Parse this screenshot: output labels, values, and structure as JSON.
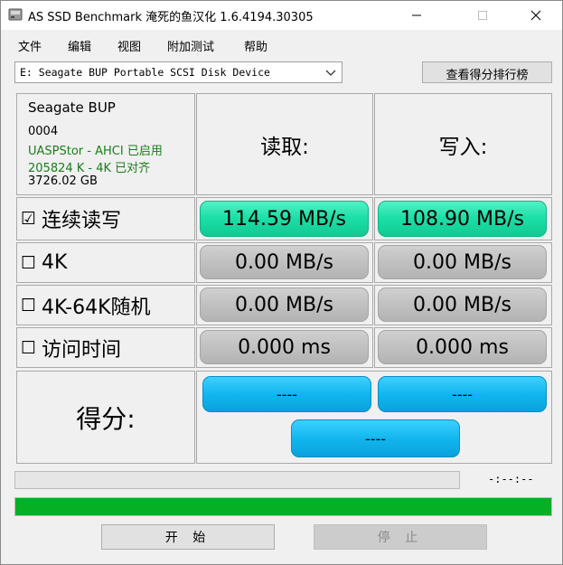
{
  "window": {
    "title": "AS SSD Benchmark 淹死的鱼汉化 1.6.4194.30305"
  },
  "menu": {
    "items": [
      "文件",
      "编辑",
      "视图",
      "附加测试",
      "帮助"
    ]
  },
  "toolbar": {
    "device_selected": "E: Seagate BUP Portable SCSI Disk Device",
    "rank_button": "查看得分排行榜"
  },
  "info": {
    "name": "Seagate BUP",
    "firmware": "0004",
    "driver": "UASPStor - AHCI 已启用",
    "alignment": "205824 K - 4K 已对齐",
    "capacity": "3726.02 GB",
    "ok_color": "#1a7d1a"
  },
  "headers": {
    "read": "读取:",
    "write": "写入:"
  },
  "rows": [
    {
      "checkbox": "☑",
      "label": "连续读写",
      "read": "114.59 MB/s",
      "write": "108.90 MB/s",
      "state": "done"
    },
    {
      "checkbox": "☐",
      "label": "4K",
      "read": "0.00 MB/s",
      "write": "0.00 MB/s",
      "state": "skipped"
    },
    {
      "checkbox": "☐",
      "label": "4K-64K随机",
      "read": "0.00 MB/s",
      "write": "0.00 MB/s",
      "state": "skipped"
    },
    {
      "checkbox": "☐",
      "label": "访问时间",
      "read": "0.000 ms",
      "write": "0.000 ms",
      "state": "skipped"
    }
  ],
  "score": {
    "label": "得分:",
    "read": "----",
    "write": "----",
    "total": "----"
  },
  "progress": {
    "time_readout": "-:--:--",
    "overall_fraction": 1.0
  },
  "buttons": {
    "start": "开 始",
    "stop": "停 止"
  },
  "colors": {
    "result_green": "#1de0a8",
    "score_blue": "#12b6ef",
    "progress_green": "#06b025"
  }
}
